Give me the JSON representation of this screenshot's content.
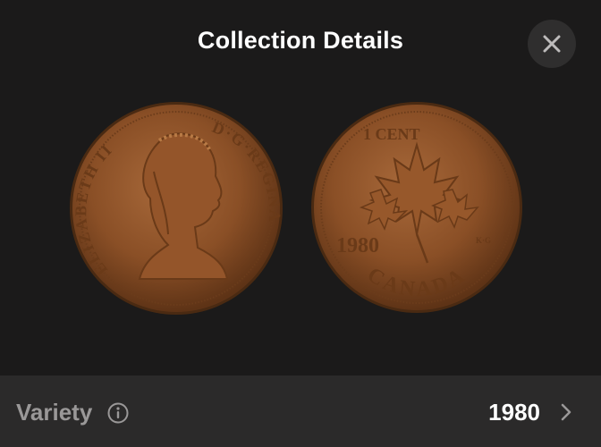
{
  "header": {
    "title": "Collection Details",
    "close_icon": "close-icon"
  },
  "coin": {
    "obverse_legend_left": "ELIZABETH II",
    "obverse_legend_right": "D·G·REGINA",
    "reverse_denomination": "1 CENT",
    "reverse_year": "1980",
    "reverse_country": "CANADA",
    "reverse_initials": "K·G"
  },
  "details": {
    "label": "Variety",
    "info_icon": "info-icon",
    "value": "1980",
    "chevron_icon": "chevron-right-icon"
  },
  "colors": {
    "background": "#1b1a1a",
    "row_background": "#2b2a2a",
    "coin_copper": "#9a5a2c"
  }
}
